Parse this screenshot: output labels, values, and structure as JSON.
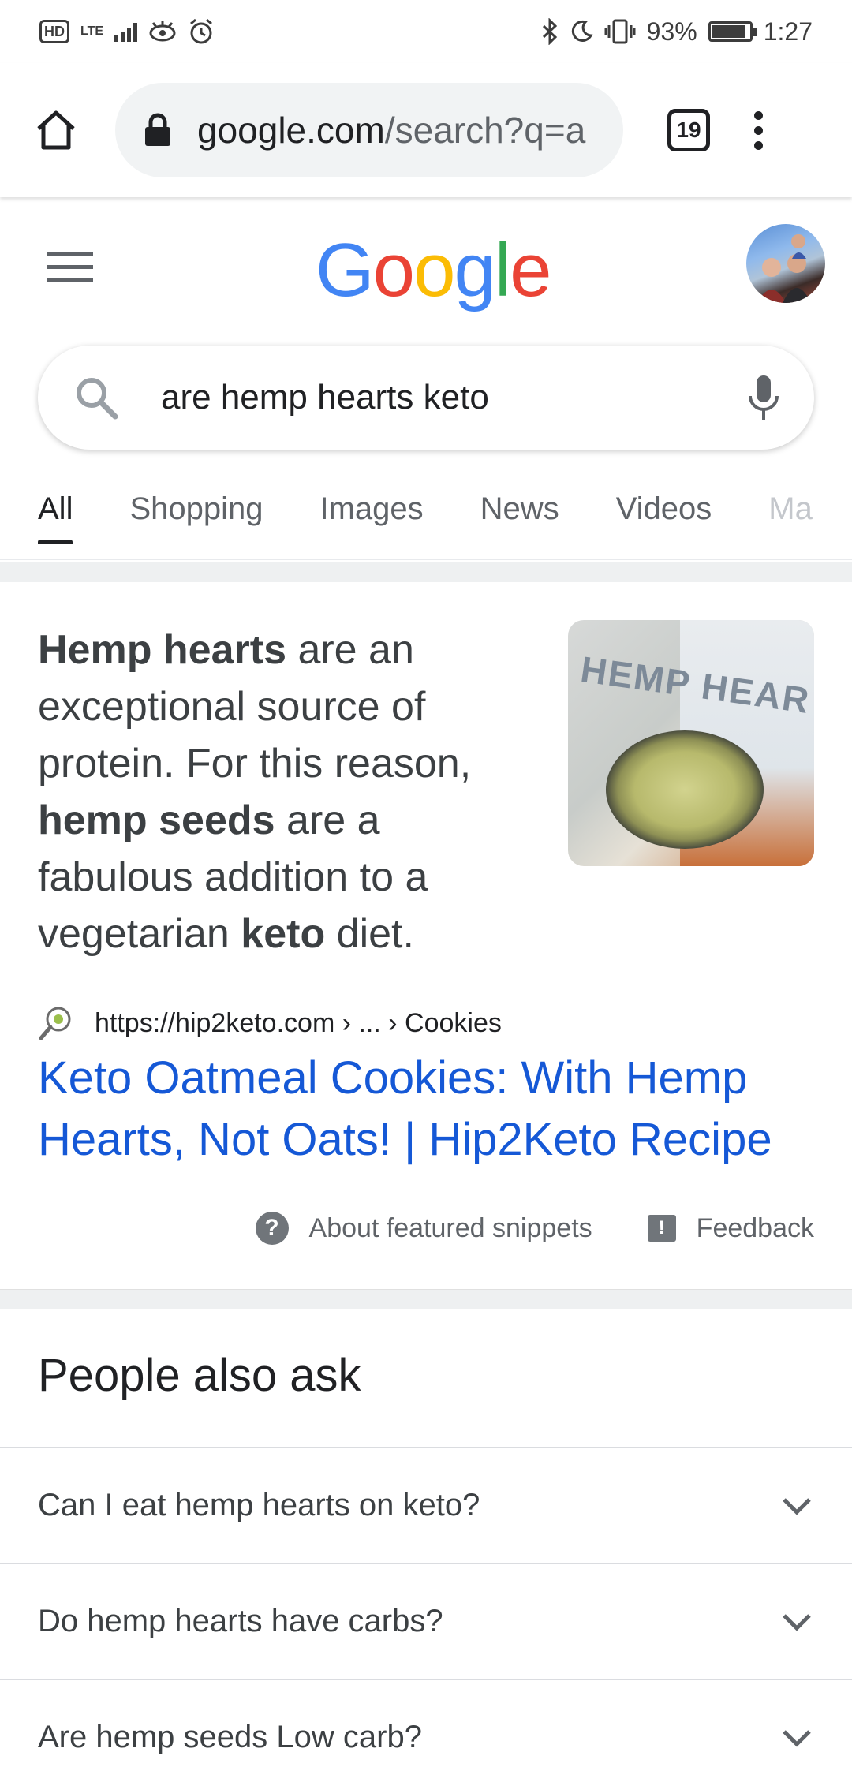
{
  "status_bar": {
    "hd": "HD",
    "network": "LTE",
    "battery": "93%",
    "time": "1:27"
  },
  "browser": {
    "url_host": "google.com",
    "url_path": "/search?q=a",
    "tab_count": "19"
  },
  "google": {
    "logo_letters": [
      "G",
      "o",
      "o",
      "g",
      "l",
      "e"
    ],
    "logo_colors": [
      "#4285F4",
      "#EA4335",
      "#FBBC05",
      "#4285F4",
      "#34A853",
      "#EA4335"
    ]
  },
  "search": {
    "query": "are hemp hearts keto"
  },
  "tabs": [
    {
      "label": "All",
      "active": true
    },
    {
      "label": "Shopping"
    },
    {
      "label": "Images"
    },
    {
      "label": "News"
    },
    {
      "label": "Videos"
    },
    {
      "label": "Ma"
    }
  ],
  "snippet": {
    "text_parts": [
      {
        "t": "Hemp hearts",
        "bold": true
      },
      {
        "t": " are an exceptional source of protein. For this reason, "
      },
      {
        "t": "hemp seeds",
        "bold": true
      },
      {
        "t": " are a fabulous addition to a vegetarian "
      },
      {
        "t": "keto",
        "bold": true
      },
      {
        "t": " diet."
      }
    ],
    "image_text": "HEMP HEAR",
    "source": "https://hip2keto.com › ... › Cookies",
    "link_title": "Keto Oatmeal Cookies: With Hemp Hearts, Not Oats! | Hip2Keto Recipe",
    "about_label": "About featured snippets",
    "feedback_label": "Feedback"
  },
  "people_also_ask": {
    "title": "People also ask",
    "questions": [
      "Can I eat hemp hearts on keto?",
      "Do hemp hearts have carbs?",
      "Are hemp seeds Low carb?"
    ]
  }
}
